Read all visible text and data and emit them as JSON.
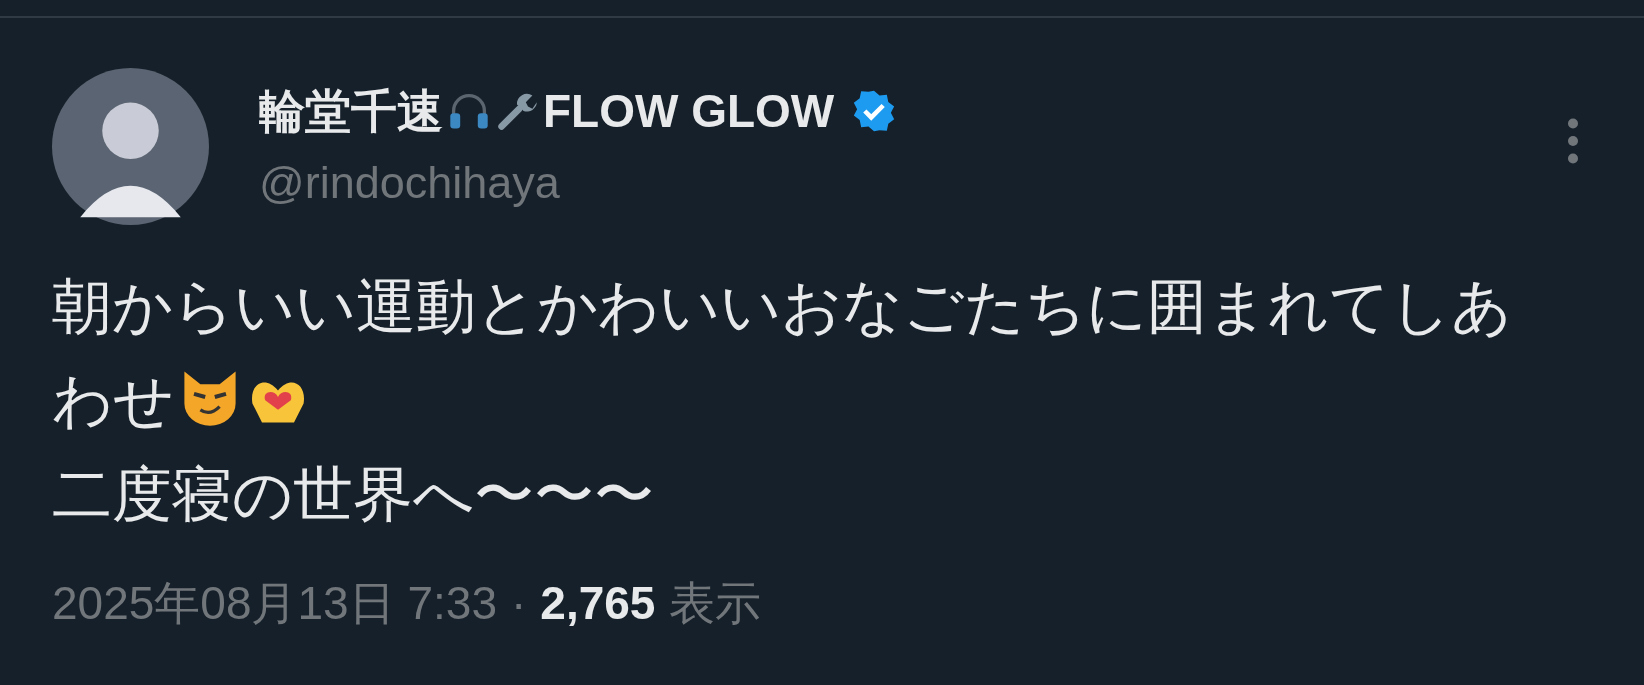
{
  "author": {
    "name_prefix": "輪堂千速",
    "name_suffix": "FLOW GLOW",
    "verified": true,
    "handle": "@rindochihaya"
  },
  "body": {
    "line_1": "朝からいい運動とかわいいおなごたちに囲まれてしあわせ",
    "line_2": "二度寝の世界へ〜〜〜"
  },
  "meta": {
    "timestamp": "2025年08月13日 7:33",
    "separator": "·",
    "views_count": "2,765",
    "views_label": "表示"
  }
}
